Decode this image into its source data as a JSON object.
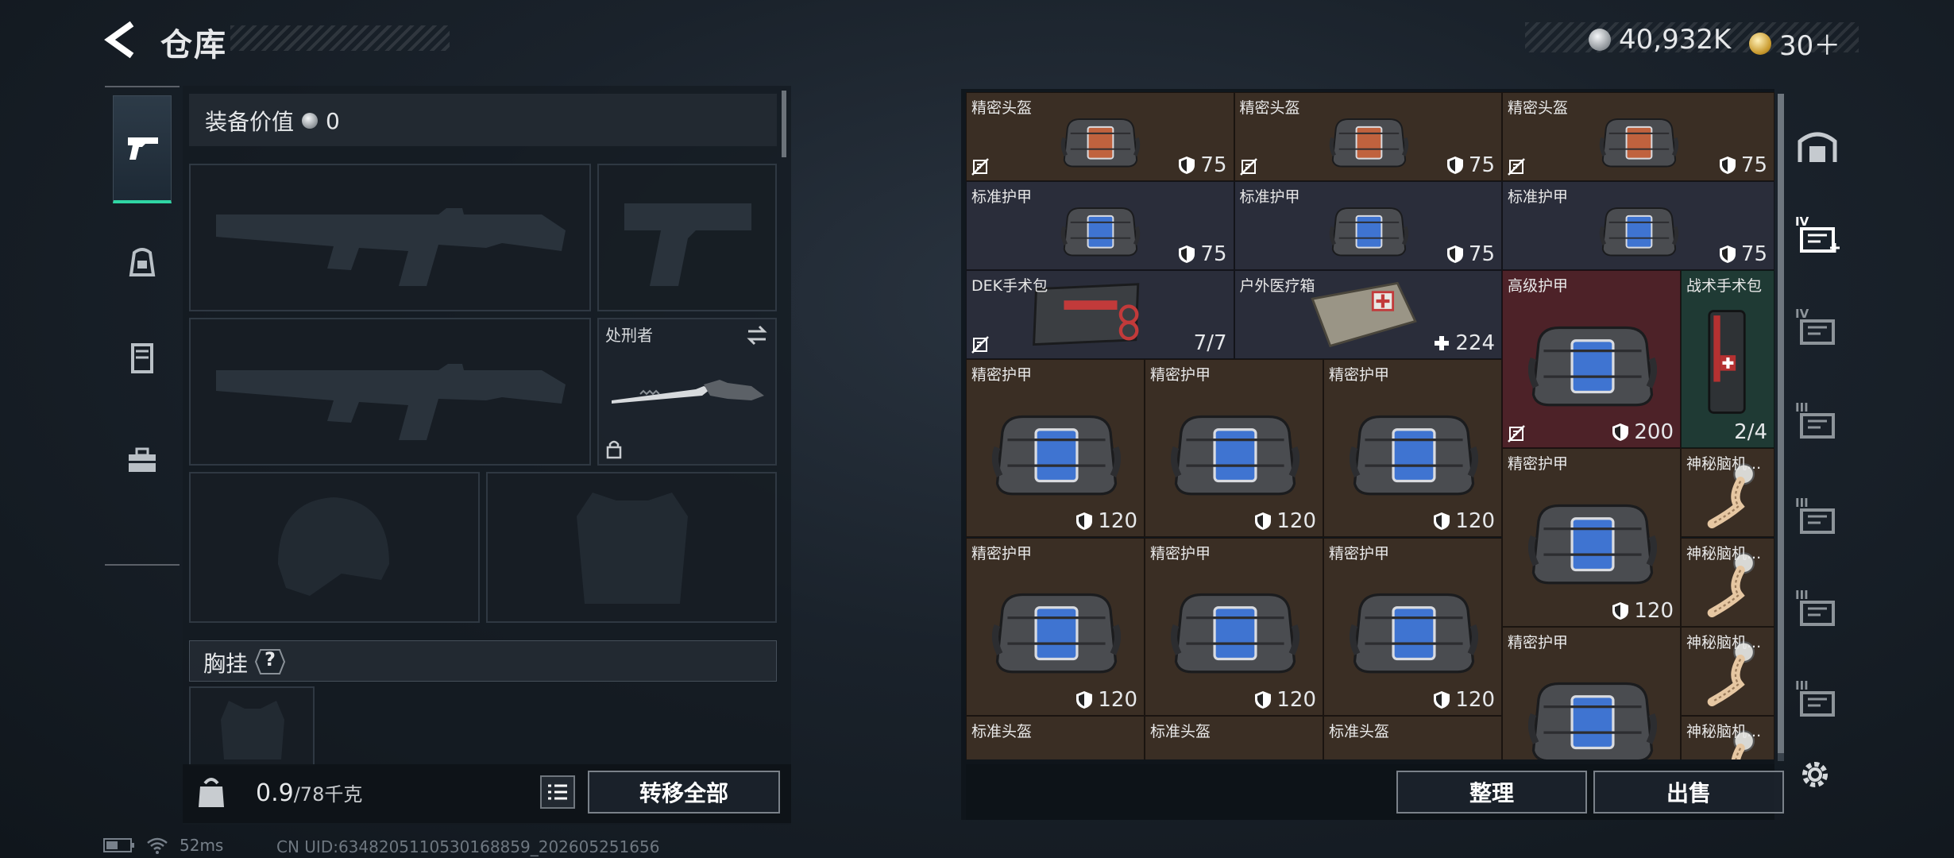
{
  "header": {
    "title": "仓库",
    "silver_amount": "40,932K",
    "gold_amount": "30＋"
  },
  "left_tabs": [
    {
      "name": "weapon",
      "active": true
    },
    {
      "name": "backpack-loadout",
      "active": false
    },
    {
      "name": "vest-loadout",
      "active": false
    },
    {
      "name": "toolbox",
      "active": false
    }
  ],
  "equipment": {
    "value_label": "装备价值",
    "value": "0",
    "melee_name": "处刑者",
    "chest_rig_label": "胸挂",
    "chest_rig_help": "?",
    "weight": "0.9",
    "weight_max": "/78千克",
    "transfer_all": "转移全部"
  },
  "grid_items": [
    {
      "name": "精密头盔",
      "value": "75",
      "type": "helmet",
      "color": "brown"
    },
    {
      "name": "精密头盔",
      "value": "75",
      "type": "helmet",
      "color": "brown"
    },
    {
      "name": "精密头盔",
      "value": "75",
      "type": "helmet",
      "color": "brown"
    },
    {
      "name": "标准护甲",
      "value": "75",
      "type": "armor",
      "color": "navy"
    },
    {
      "name": "标准护甲",
      "value": "75",
      "type": "armor",
      "color": "navy"
    },
    {
      "name": "标准护甲",
      "value": "75",
      "type": "armor",
      "color": "navy"
    },
    {
      "name": "DEK手术包",
      "value": "7/7",
      "type": "medkit",
      "color": "navy"
    },
    {
      "name": "户外医疗箱",
      "value": "224",
      "type": "medbox",
      "color": "navy"
    },
    {
      "name": "高级护甲",
      "value": "200",
      "type": "armor",
      "color": "red"
    },
    {
      "name": "战术手术包",
      "value": "2/4",
      "type": "surgery",
      "color": "green"
    },
    {
      "name": "精密护甲",
      "value": "120",
      "type": "armor",
      "color": "brown"
    },
    {
      "name": "精密护甲",
      "value": "120",
      "type": "armor",
      "color": "brown"
    },
    {
      "name": "精密护甲",
      "value": "120",
      "type": "armor",
      "color": "brown"
    },
    {
      "name": "精密护甲",
      "value": "120",
      "type": "armor",
      "color": "brown"
    },
    {
      "name": "神秘脑机...",
      "value": "",
      "type": "chip",
      "color": "brown"
    },
    {
      "name": "精密护甲",
      "value": "120",
      "type": "armor",
      "color": "brown"
    },
    {
      "name": "精密护甲",
      "value": "120",
      "type": "armor",
      "color": "brown"
    },
    {
      "name": "精密护甲",
      "value": "120",
      "type": "armor",
      "color": "brown"
    },
    {
      "name": "神秘脑机...",
      "value": "",
      "type": "chip",
      "color": "brown"
    },
    {
      "name": "精密护甲",
      "value": "",
      "type": "armor",
      "color": "brown"
    },
    {
      "name": "神秘脑机...",
      "value": "",
      "type": "chip",
      "color": "brown"
    },
    {
      "name": "标准头盔",
      "value": "",
      "type": "helmet",
      "color": "brown"
    },
    {
      "name": "标准头盔",
      "value": "",
      "type": "helmet",
      "color": "brown"
    },
    {
      "name": "标准头盔",
      "value": "",
      "type": "helmet",
      "color": "brown"
    },
    {
      "name": "神秘脑机...",
      "value": "",
      "type": "chip",
      "color": "brown"
    }
  ],
  "grid_buttons": {
    "sort": "整理",
    "sell": "出售"
  },
  "right_tabs": [
    {
      "icon": "storage-icon"
    },
    {
      "icon": "container-iv-plus-icon",
      "label": "IV"
    },
    {
      "icon": "container-iv-icon",
      "label": "IV"
    },
    {
      "icon": "container-iii-icon",
      "label": "III"
    },
    {
      "icon": "container-iii-icon",
      "label": "III"
    },
    {
      "icon": "container-iii-icon",
      "label": "III"
    },
    {
      "icon": "container-iii-icon",
      "label": "III"
    }
  ],
  "status": {
    "ping": "52ms",
    "uid": "CN UID:6348205110530168859_202605251656"
  },
  "colors": {
    "accent": "#30d6a4",
    "cell_brown": "#3a2e24",
    "cell_navy": "#2a2d3a",
    "cell_red": "#4d2228",
    "cell_green": "#1f3a34"
  }
}
